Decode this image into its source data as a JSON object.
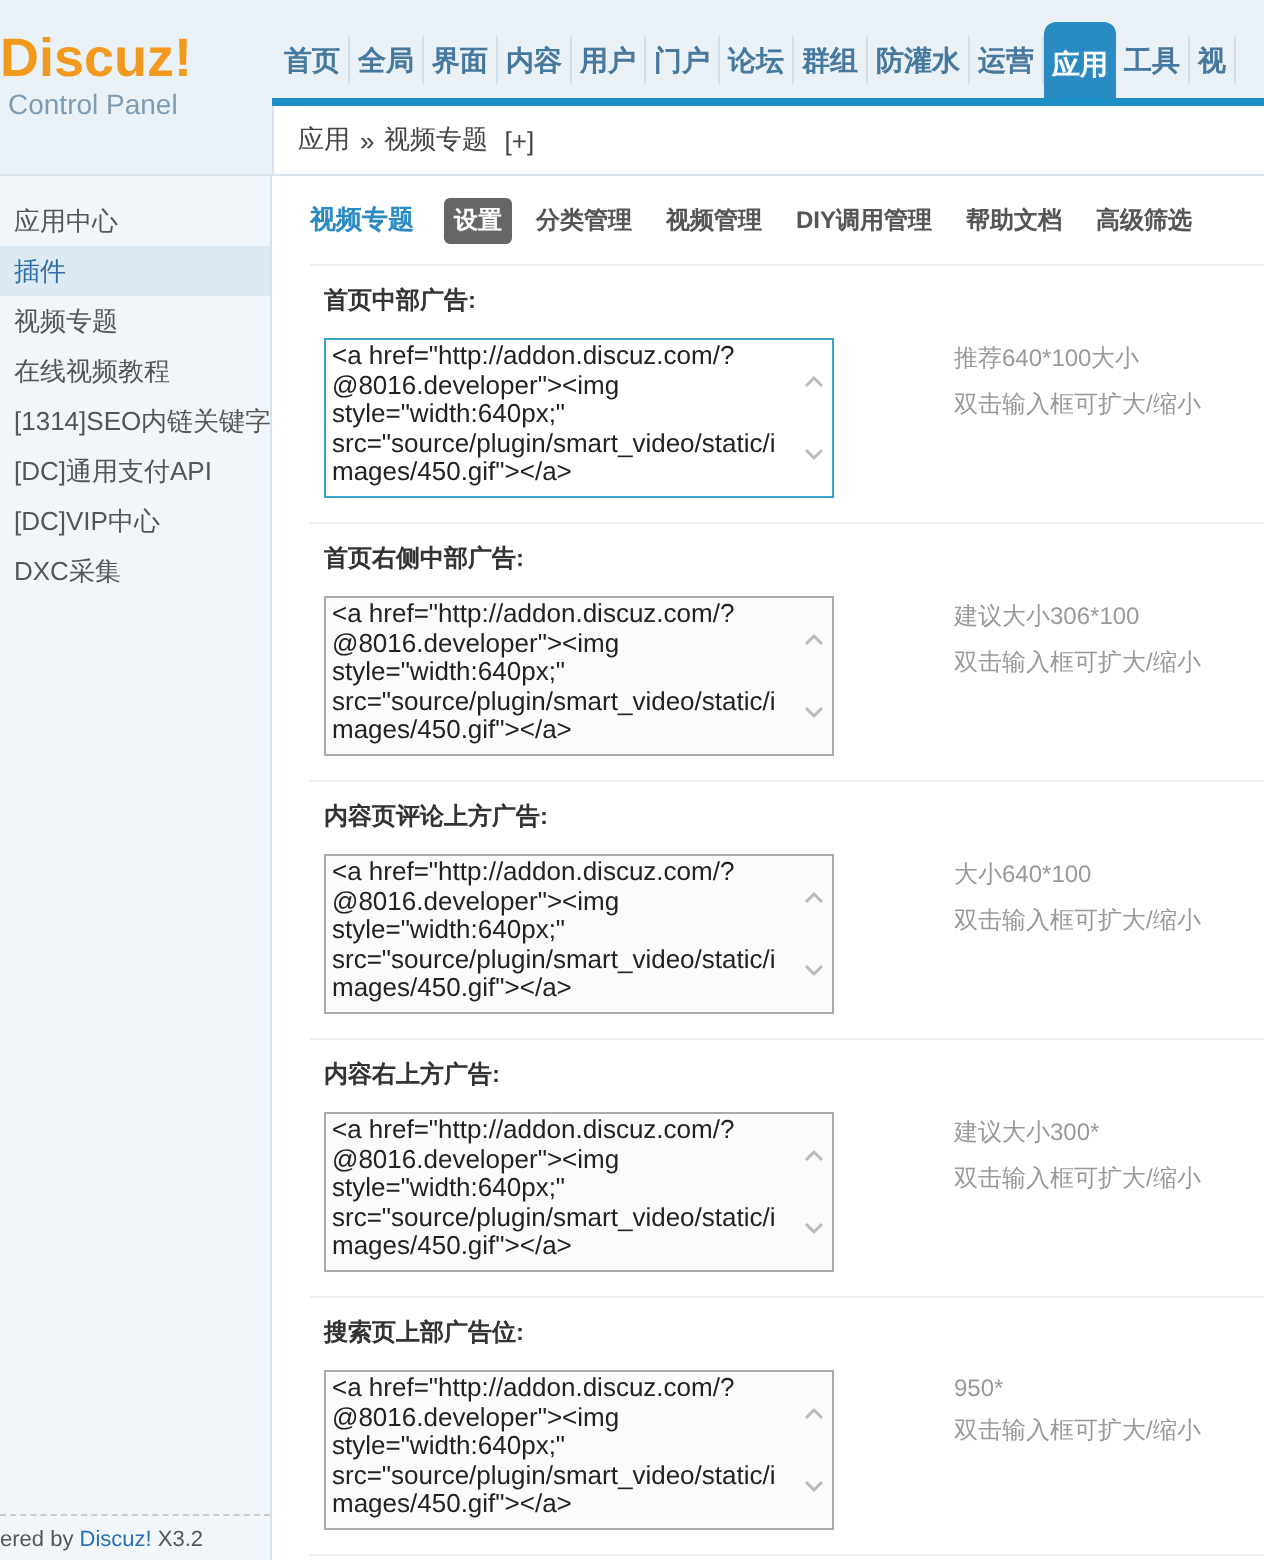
{
  "logo": {
    "name": "Discuz!",
    "subtitle": "Control Panel"
  },
  "nav": [
    {
      "label": "首页",
      "selected": false
    },
    {
      "label": "全局",
      "selected": false
    },
    {
      "label": "界面",
      "selected": false
    },
    {
      "label": "内容",
      "selected": false
    },
    {
      "label": "用户",
      "selected": false
    },
    {
      "label": "门户",
      "selected": false
    },
    {
      "label": "论坛",
      "selected": false
    },
    {
      "label": "群组",
      "selected": false
    },
    {
      "label": "防灌水",
      "selected": false
    },
    {
      "label": "运营",
      "selected": false
    },
    {
      "label": "应用",
      "selected": true
    },
    {
      "label": "工具",
      "selected": false
    },
    {
      "label": "视",
      "selected": false
    }
  ],
  "breadcrumb": {
    "parent": "应用",
    "separator": "»",
    "current": "视频专题",
    "add": "[+]"
  },
  "sidebar": {
    "items": [
      {
        "label": "应用中心",
        "selected": false
      },
      {
        "label": "插件",
        "selected": true
      },
      {
        "label": "视频专题",
        "selected": false
      },
      {
        "label": "在线视频教程",
        "selected": false
      },
      {
        "label": "[1314]SEO内链关键字",
        "selected": false
      },
      {
        "label": "[DC]通用支付API",
        "selected": false
      },
      {
        "label": "[DC]VIP中心",
        "selected": false
      },
      {
        "label": "DXC采集",
        "selected": false
      }
    ],
    "footer": {
      "prefix": "ered by ",
      "link": "Discuz!",
      "suffix": " X3.2"
    }
  },
  "plugin_title": "视频专题",
  "sub_tabs": [
    {
      "label": "设置",
      "selected": true
    },
    {
      "label": "分类管理",
      "selected": false
    },
    {
      "label": "视频管理",
      "selected": false
    },
    {
      "label": "DIY调用管理",
      "selected": false
    },
    {
      "label": "帮助文档",
      "selected": false
    },
    {
      "label": "高级筛选",
      "selected": false
    }
  ],
  "settings": [
    {
      "label": "首页中部广告:",
      "value": "<a href=\"http://addon.discuz.com/?@8016.developer\"><img style=\"width:640px;\" src=\"source/plugin/smart_video/static/images/450.gif\"></a>",
      "focused": true,
      "hint": "推荐640*100大小",
      "note": "双击输入框可扩大/缩小"
    },
    {
      "label": "首页右侧中部广告:",
      "value": "<a href=\"http://addon.discuz.com/?@8016.developer\"><img style=\"width:640px;\" src=\"source/plugin/smart_video/static/images/450.gif\"></a>",
      "focused": false,
      "hint": "建议大小306*100",
      "note": "双击输入框可扩大/缩小"
    },
    {
      "label": "内容页评论上方广告:",
      "value": "<a href=\"http://addon.discuz.com/?@8016.developer\"><img style=\"width:640px;\" src=\"source/plugin/smart_video/static/images/450.gif\"></a>",
      "focused": false,
      "hint": "大小640*100",
      "note": "双击输入框可扩大/缩小"
    },
    {
      "label": "内容右上方广告:",
      "value": "<a href=\"http://addon.discuz.com/?@8016.developer\"><img style=\"width:640px;\" src=\"source/plugin/smart_video/static/images/450.gif\"></a>",
      "focused": false,
      "hint": "建议大小300*",
      "note": "双击输入框可扩大/缩小"
    },
    {
      "label": "搜索页上部广告位:",
      "value": "<a href=\"http://addon.discuz.com/?@8016.developer\"><img style=\"width:640px;\" src=\"source/plugin/smart_video/static/images/450.gif\"></a>",
      "focused": false,
      "hint": "950*",
      "note": "双击输入框可扩大/缩小"
    }
  ]
}
